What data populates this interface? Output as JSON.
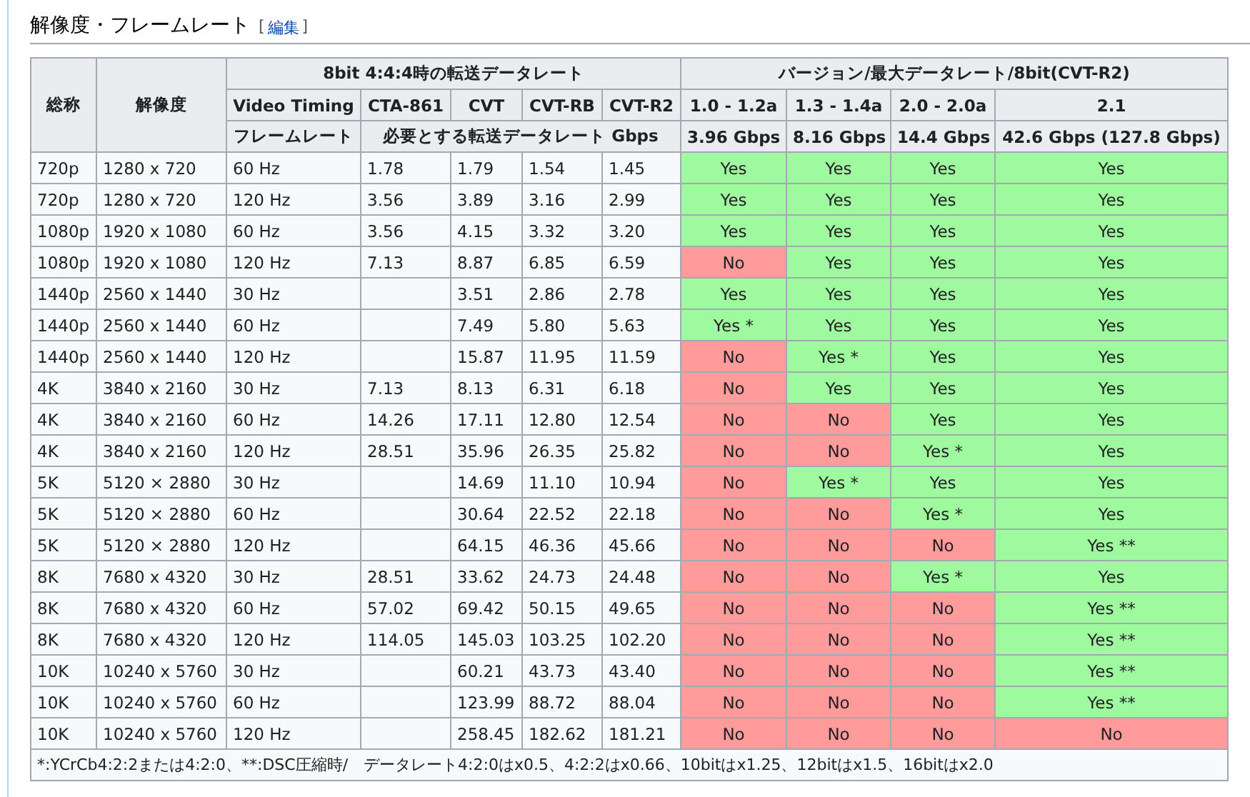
{
  "section": {
    "title": "解像度・フレームレート",
    "edit_open": "[",
    "edit_label": "編集",
    "edit_close": "]"
  },
  "table": {
    "header_rows": [
      [
        "総称",
        "解像度",
        "8bit 4:4:4時の転送データレート",
        "バージョン/最大データレート/8bit(CVT-R2)"
      ],
      [
        "Video Timing",
        "CTA-861",
        "CVT",
        "CVT-RB",
        "CVT-R2",
        "1.0 - 1.2a",
        "1.3 - 1.4a",
        "2.0 - 2.0a",
        "2.1"
      ],
      [
        "フレームレート",
        "必要とする転送データレート Gbps",
        "3.96 Gbps",
        "8.16 Gbps",
        "14.4 Gbps",
        "42.6 Gbps (127.8 Gbps)"
      ]
    ],
    "rows": [
      {
        "name": "720p",
        "resolution": "1280 x 720",
        "frame_rate": "60 Hz",
        "cta_861": "1.78",
        "cvt": "1.79",
        "cvt_rb": "1.54",
        "cvt_r2": "1.45",
        "support": [
          {
            "text": "Yes",
            "supported": true
          },
          {
            "text": "Yes",
            "supported": true
          },
          {
            "text": "Yes",
            "supported": true
          },
          {
            "text": "Yes",
            "supported": true
          }
        ]
      },
      {
        "name": "720p",
        "resolution": "1280 x 720",
        "frame_rate": "120 Hz",
        "cta_861": "3.56",
        "cvt": "3.89",
        "cvt_rb": "3.16",
        "cvt_r2": "2.99",
        "support": [
          {
            "text": "Yes",
            "supported": true
          },
          {
            "text": "Yes",
            "supported": true
          },
          {
            "text": "Yes",
            "supported": true
          },
          {
            "text": "Yes",
            "supported": true
          }
        ]
      },
      {
        "name": "1080p",
        "resolution": "1920 x 1080",
        "frame_rate": "60 Hz",
        "cta_861": "3.56",
        "cvt": "4.15",
        "cvt_rb": "3.32",
        "cvt_r2": "3.20",
        "support": [
          {
            "text": "Yes",
            "supported": true
          },
          {
            "text": "Yes",
            "supported": true
          },
          {
            "text": "Yes",
            "supported": true
          },
          {
            "text": "Yes",
            "supported": true
          }
        ]
      },
      {
        "name": "1080p",
        "resolution": "1920 x 1080",
        "frame_rate": "120 Hz",
        "cta_861": "7.13",
        "cvt": "8.87",
        "cvt_rb": "6.85",
        "cvt_r2": "6.59",
        "support": [
          {
            "text": "No",
            "supported": false
          },
          {
            "text": "Yes",
            "supported": true
          },
          {
            "text": "Yes",
            "supported": true
          },
          {
            "text": "Yes",
            "supported": true
          }
        ]
      },
      {
        "name": "1440p",
        "resolution": "2560 x 1440",
        "frame_rate": "30 Hz",
        "cvt": "3.51",
        "cvt_rb": "2.86",
        "cvt_r2": "2.78",
        "support": [
          {
            "text": "Yes",
            "supported": true
          },
          {
            "text": "Yes",
            "supported": true
          },
          {
            "text": "Yes",
            "supported": true
          },
          {
            "text": "Yes",
            "supported": true
          }
        ]
      },
      {
        "name": "1440p",
        "resolution": "2560 x 1440",
        "frame_rate": "60 Hz",
        "cvt": "7.49",
        "cvt_rb": "5.80",
        "cvt_r2": "5.63",
        "support": [
          {
            "text": "Yes *",
            "supported": true
          },
          {
            "text": "Yes",
            "supported": true
          },
          {
            "text": "Yes",
            "supported": true
          },
          {
            "text": "Yes",
            "supported": true
          }
        ]
      },
      {
        "name": "1440p",
        "resolution": "2560 x 1440",
        "frame_rate": "120 Hz",
        "cvt": "15.87",
        "cvt_rb": "11.95",
        "cvt_r2": "11.59",
        "support": [
          {
            "text": "No",
            "supported": false
          },
          {
            "text": "Yes *",
            "supported": true
          },
          {
            "text": "Yes",
            "supported": true
          },
          {
            "text": "Yes",
            "supported": true
          }
        ]
      },
      {
        "name": "4K",
        "resolution": "3840 x 2160",
        "frame_rate": "30 Hz",
        "cta_861": "7.13",
        "cvt": "8.13",
        "cvt_rb": "6.31",
        "cvt_r2": "6.18",
        "support": [
          {
            "text": "No",
            "supported": false
          },
          {
            "text": "Yes",
            "supported": true
          },
          {
            "text": "Yes",
            "supported": true
          },
          {
            "text": "Yes",
            "supported": true
          }
        ]
      },
      {
        "name": "4K",
        "resolution": "3840 x 2160",
        "frame_rate": "60 Hz",
        "cta_861": "14.26",
        "cvt": "17.11",
        "cvt_rb": "12.80",
        "cvt_r2": "12.54",
        "support": [
          {
            "text": "No",
            "supported": false
          },
          {
            "text": "No",
            "supported": false
          },
          {
            "text": "Yes",
            "supported": true
          },
          {
            "text": "Yes",
            "supported": true
          }
        ]
      },
      {
        "name": "4K",
        "resolution": "3840 x 2160",
        "frame_rate": "120 Hz",
        "cta_861": "28.51",
        "cvt": "35.96",
        "cvt_rb": "26.35",
        "cvt_r2": "25.82",
        "support": [
          {
            "text": "No",
            "supported": false
          },
          {
            "text": "No",
            "supported": false
          },
          {
            "text": "Yes *",
            "supported": true
          },
          {
            "text": "Yes",
            "supported": true
          }
        ]
      },
      {
        "name": "5K",
        "resolution": "5120 × 2880",
        "frame_rate": "30 Hz",
        "cvt": "14.69",
        "cvt_rb": "11.10",
        "cvt_r2": "10.94",
        "support": [
          {
            "text": "No",
            "supported": false
          },
          {
            "text": "Yes *",
            "supported": true
          },
          {
            "text": "Yes",
            "supported": true
          },
          {
            "text": "Yes",
            "supported": true
          }
        ]
      },
      {
        "name": "5K",
        "resolution": "5120 × 2880",
        "frame_rate": "60 Hz",
        "cvt": "30.64",
        "cvt_rb": "22.52",
        "cvt_r2": "22.18",
        "support": [
          {
            "text": "No",
            "supported": false
          },
          {
            "text": "No",
            "supported": false
          },
          {
            "text": "Yes *",
            "supported": true
          },
          {
            "text": "Yes",
            "supported": true
          }
        ]
      },
      {
        "name": "5K",
        "resolution": "5120 × 2880",
        "frame_rate": "120 Hz",
        "cvt": "64.15",
        "cvt_rb": "46.36",
        "cvt_r2": "45.66",
        "support": [
          {
            "text": "No",
            "supported": false
          },
          {
            "text": "No",
            "supported": false
          },
          {
            "text": "No",
            "supported": false
          },
          {
            "text": "Yes **",
            "supported": true
          }
        ]
      },
      {
        "name": "8K",
        "resolution": "7680 x 4320",
        "frame_rate": "30 Hz",
        "cta_861": "28.51",
        "cvt": "33.62",
        "cvt_rb": "24.73",
        "cvt_r2": "24.48",
        "support": [
          {
            "text": "No",
            "supported": false
          },
          {
            "text": "No",
            "supported": false
          },
          {
            "text": "Yes *",
            "supported": true
          },
          {
            "text": "Yes",
            "supported": true
          }
        ]
      },
      {
        "name": "8K",
        "resolution": "7680 x 4320",
        "frame_rate": "60 Hz",
        "cta_861": "57.02",
        "cvt": "69.42",
        "cvt_rb": "50.15",
        "cvt_r2": "49.65",
        "support": [
          {
            "text": "No",
            "supported": false
          },
          {
            "text": "No",
            "supported": false
          },
          {
            "text": "No",
            "supported": false
          },
          {
            "text": "Yes **",
            "supported": true
          }
        ]
      },
      {
        "name": "8K",
        "resolution": "7680 x 4320",
        "frame_rate": "120 Hz",
        "cta_861": "114.05",
        "cvt": "145.03",
        "cvt_rb": "103.25",
        "cvt_r2": "102.20",
        "support": [
          {
            "text": "No",
            "supported": false
          },
          {
            "text": "No",
            "supported": false
          },
          {
            "text": "No",
            "supported": false
          },
          {
            "text": "Yes **",
            "supported": true
          }
        ]
      },
      {
        "name": "10K",
        "resolution": "10240 x 5760",
        "frame_rate": "30 Hz",
        "cvt": "60.21",
        "cvt_rb": "43.73",
        "cvt_r2": "43.40",
        "support": [
          {
            "text": "No",
            "supported": false
          },
          {
            "text": "No",
            "supported": false
          },
          {
            "text": "No",
            "supported": false
          },
          {
            "text": "Yes **",
            "supported": true
          }
        ]
      },
      {
        "name": "10K",
        "resolution": "10240 x 5760",
        "frame_rate": "60 Hz",
        "cvt": "123.99",
        "cvt_rb": "88.72",
        "cvt_r2": "88.04",
        "support": [
          {
            "text": "No",
            "supported": false
          },
          {
            "text": "No",
            "supported": false
          },
          {
            "text": "No",
            "supported": false
          },
          {
            "text": "Yes **",
            "supported": true
          }
        ]
      },
      {
        "name": "10K",
        "resolution": "10240 x 5760",
        "frame_rate": "120 Hz",
        "cvt": "258.45",
        "cvt_rb": "182.62",
        "cvt_r2": "181.21",
        "support": [
          {
            "text": "No",
            "supported": false
          },
          {
            "text": "No",
            "supported": false
          },
          {
            "text": "No",
            "supported": false
          },
          {
            "text": "No",
            "supported": false
          }
        ]
      }
    ],
    "footnote": "*:YCrCb4:2:2または4:2:0、**:DSC圧縮時/　データレート4:2:0はx0.5、4:2:2はx0.66、10bitはx1.25、12bitはx1.5、16bitはx2.0"
  }
}
